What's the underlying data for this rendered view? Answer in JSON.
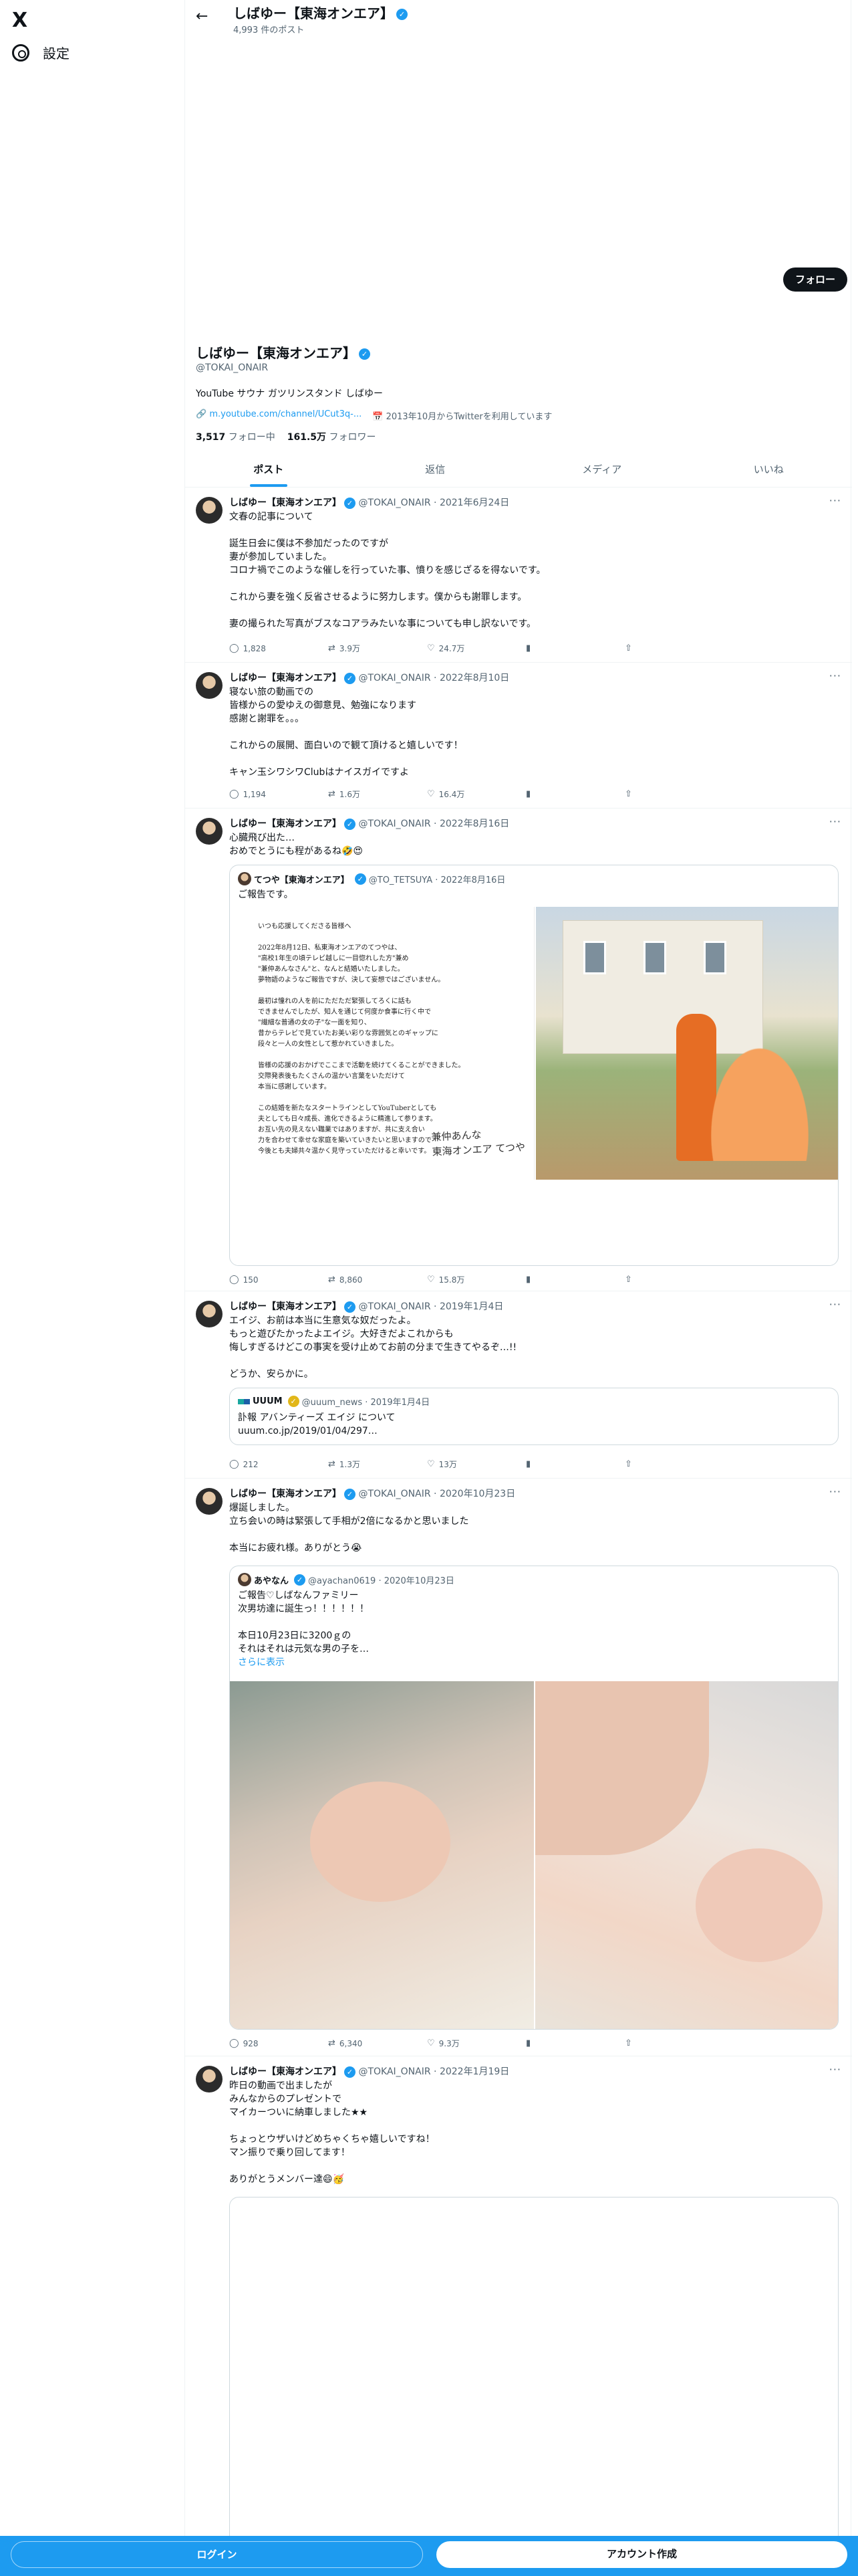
{
  "sidebar": {
    "logo": "X",
    "settings_label": "設定",
    "settings_icon": "gear-icon"
  },
  "profile": {
    "name": "しばゆー【東海オンエア】",
    "post_count": "4,993 件のポスト",
    "follow_button": "フォロー",
    "handle": "@TOKAI_ONAIR",
    "bio": "YouTube サウナ ガツリンスタンド しばゆー",
    "link": "m.youtube.com/channel/UCut3q-...",
    "joined": "2013年10月からTwitterを利用しています",
    "following_count": "3,517",
    "following_label": "フォロー中",
    "followers_count": "161.5万",
    "followers_label": "フォロワー"
  },
  "tabs": [
    "ポスト",
    "返信",
    "メディア",
    "いいね"
  ],
  "tweets": [
    {
      "name": "しばゆー【東海オンエア】",
      "meta": "@TOKAI_ONAIR · 2021年6月24日",
      "text": "文春の記事について\n\n誕生日会に僕は不参加だったのですが\n妻が参加していました。\nコロナ禍でこのような催しを行っていた事、憤りを感じざるを得ないです。\n\nこれから妻を強く反省させるように努力します。僕からも謝罪します。\n\n妻の撮られた写真がブスなコアラみたいな事についても申し訳ないです。",
      "replies": "1,828",
      "retweets": "3.9万",
      "likes": "24.7万"
    },
    {
      "name": "しばゆー【東海オンエア】",
      "meta": "@TOKAI_ONAIR · 2022年8月10日",
      "text": "寝ない旅の動画での\n皆様からの愛ゆえの御意見、勉強になります\n感謝と謝罪を。。。\n\nこれからの展開、面白いので観て頂けると嬉しいです！\n\nキャン玉シワシワClubはナイスガイですよ",
      "replies": "1,194",
      "retweets": "1.6万",
      "likes": "16.4万"
    },
    {
      "name": "しばゆー【東海オンエア】",
      "meta": "@TOKAI_ONAIR · 2022年8月16日",
      "text": "心臓飛び出た…\nおめでとうにも程があるね🤣😍",
      "quote": {
        "name": "てつや【東海オンエア】",
        "meta": "@TO_TETSUYA · 2022年8月16日",
        "text": "ご報告です。",
        "letter": "いつも応援してくださる皆様へ\n\n2022年8月12日、私東海オンエアのてつやは、\n\"高校1年生の頃テレビ越しに一目惚れした方\"兼め\n\"兼仲あんなさん\"と、なんと結婚いたしました。\n夢物語のようなご報告ですが、決して妄想ではございません。\n\n最初は憧れの人を前にただただ緊張してろくに話も\nできませんでしたが、知人を通じて何度か食事に行く中で\n\"繊細な普通の女の子\"な一面を知り、\n昔からテレビで見ていたお美い彩りな雰囲気とのギャップに\n段々と一人の女性として惹かれていきました。\n\n皆様の応援のおかげでここまで活動を続けてくることができました。\n交際発表後もたくさんの温かい言葉をいただけて\n本当に感謝しています。\n\nこの結婚を新たなスタートラインとしてYouTuberとしても\n夫としても日々成長、進化できるように精進して参ります。\nお互い先の見えない職業ではありますが、共に支え合い\n力を合わせて幸せな家庭を築いていきたいと思いますので\n今後とも夫婦共々温かく見守っていただけると幸いです。",
        "signature": "兼仲あんな\n東海オンエア てつや"
      },
      "replies": "150",
      "retweets": "8,860",
      "likes": "15.8万"
    },
    {
      "name": "しばゆー【東海オンエア】",
      "meta": "@TOKAI_ONAIR · 2019年1月4日",
      "text": "エイジ、お前は本当に生意気な奴だったよ。\nもっと遊びたかったよエイジ。大好きだよこれからも\n悔しすぎるけどこの事実を受け止めてお前の分まで生きてやるぞ…!!\n\nどうか、安らかに。",
      "quote": {
        "name": "UUUM",
        "meta": "@uuum_news · 2019年1月4日",
        "text": "訃報 アバンティーズ エイジ について\nuuum.co.jp/2019/01/04/297…"
      },
      "replies": "212",
      "retweets": "1.3万",
      "likes": "13万"
    },
    {
      "name": "しばゆー【東海オンエア】",
      "meta": "@TOKAI_ONAIR · 2020年10月23日",
      "text": "爆誕しました。\n立ち会いの時は緊張して手相が2倍になるかと思いました\n\n本当にお疲れ様。ありがとう😭",
      "quote": {
        "name": "あやなん",
        "meta": "@ayachan0619 · 2020年10月23日",
        "text": "ご報告♡しばなんファミリー\n次男坊達に誕生っ！！！！！！\n\n本日10月23日に3200ｇの\nそれはそれは元気な男の子を…",
        "more": "さらに表示"
      },
      "replies": "928",
      "retweets": "6,340",
      "likes": "9.3万"
    },
    {
      "name": "しばゆー【東海オンエア】",
      "meta": "@TOKAI_ONAIR · 2022年1月19日",
      "text": "昨日の動画で出ましたが\nみんなからのプレゼントで\nマイカーついに納車しました★★\n\nちょっとウザいけどめちゃくちゃ嬉しいですね！\nマン振りで乗り回してます！\n\nありがとうメンバー達😄🥳"
    }
  ],
  "bottom": {
    "login": "ログイン",
    "signup": "アカウント作成"
  }
}
